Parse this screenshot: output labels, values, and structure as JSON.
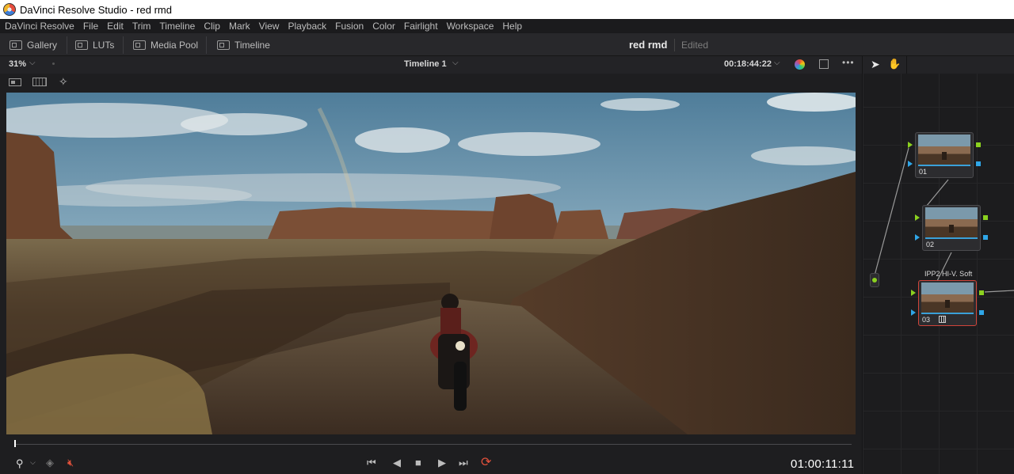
{
  "window": {
    "title": "DaVinci Resolve Studio - red rmd"
  },
  "menu": [
    "DaVinci Resolve",
    "File",
    "Edit",
    "Trim",
    "Timeline",
    "Clip",
    "Mark",
    "View",
    "Playback",
    "Fusion",
    "Color",
    "Fairlight",
    "Workspace",
    "Help"
  ],
  "toolbar": {
    "gallery": "Gallery",
    "luts": "LUTs",
    "media_pool": "Media Pool",
    "timeline": "Timeline",
    "project_name": "red rmd",
    "project_status": "Edited"
  },
  "viewer": {
    "zoom": "31%",
    "timeline_name": "Timeline 1",
    "source_timecode": "00:18:44:22",
    "record_timecode": "01:00:11:11",
    "playhead_fraction": 0.0
  },
  "transport": {
    "rewind_icon": "skip-back-icon",
    "reverse_icon": "play-reverse-icon",
    "stop_icon": "stop-icon",
    "play_icon": "play-icon",
    "forward_icon": "skip-forward-icon",
    "loop_icon": "loop-icon"
  },
  "nodes": [
    {
      "label": "01",
      "selected": false
    },
    {
      "label": "02",
      "selected": false
    },
    {
      "label": "03",
      "selected": true,
      "title": "IPP2 HI-V. Soft"
    }
  ],
  "colors": {
    "accent_red": "#e2513b",
    "port_green": "#8bd11f",
    "port_blue": "#2fa6e8",
    "selection": "#d0443a"
  }
}
